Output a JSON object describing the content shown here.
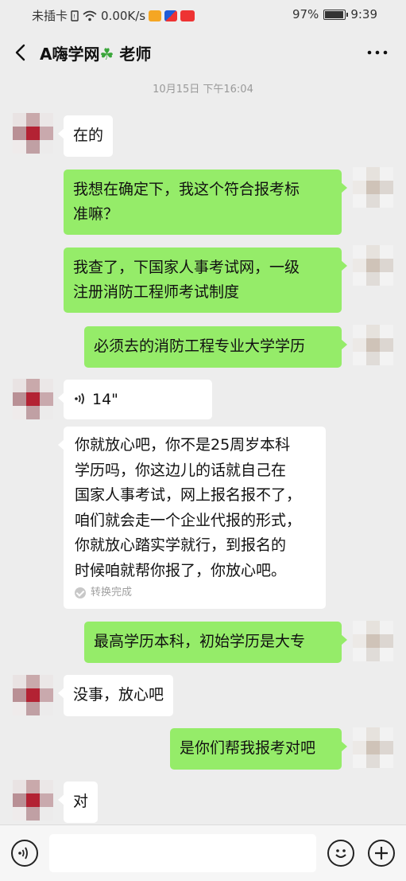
{
  "status_bar": {
    "carrier": "未插卡",
    "speed": "0.00K/s",
    "battery": "97%",
    "battery_level": 0.97,
    "time": "9:39"
  },
  "header": {
    "title_prefix": "A嗨学网",
    "clover": "☘",
    "title_suffix": " 老师"
  },
  "chat": {
    "timestamp": "10月15日 下午16:04",
    "messages": [
      {
        "from": "them",
        "text": "在的"
      },
      {
        "from": "me",
        "lines": [
          "我想在确定下，我这个符合报考标",
          "准嘛？"
        ]
      },
      {
        "from": "me",
        "lines": [
          "我查了，下国家人事考试网，一级",
          "注册消防工程师考试制度"
        ]
      },
      {
        "from": "me",
        "text": "必须去的消防工程专业大学学历"
      },
      {
        "from": "them",
        "type": "voice",
        "duration": "14\""
      },
      {
        "from": "them",
        "type": "transcript",
        "lines": [
          "你就放心吧，你不是25周岁本科",
          "学历吗，你这边儿的话就自己在",
          "国家人事考试，网上报名报不了，",
          "咱们就会走一个企业代报的形式，",
          "你就放心踏实学就行，到报名的",
          "时候咱就帮你报了，你放心吧。"
        ],
        "status": "转换完成"
      },
      {
        "from": "me",
        "text": "最高学历本科，初始学历是大专"
      },
      {
        "from": "them",
        "text": "没事，放心吧"
      },
      {
        "from": "me",
        "text": "是你们帮我报考对吧"
      },
      {
        "from": "them",
        "text": "对"
      }
    ]
  },
  "input_bar": {
    "value": ""
  },
  "colors": {
    "sent_bubble": "#95ec69",
    "received_bubble": "#ffffff",
    "background": "#ededed"
  }
}
